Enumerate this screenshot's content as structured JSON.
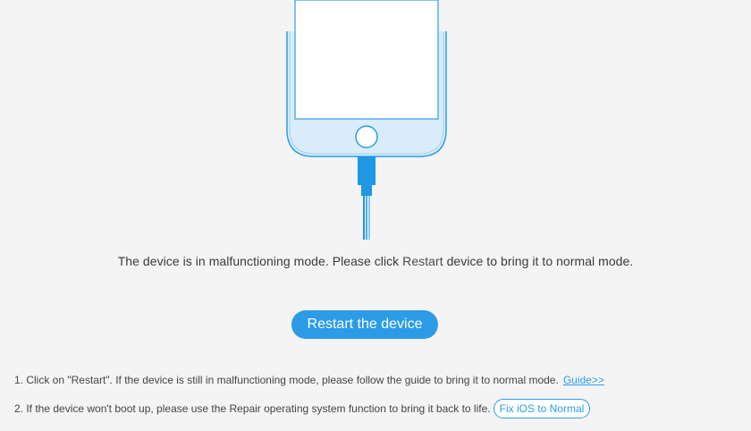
{
  "illustration": {
    "phone_outline_color": "#2c9ce6",
    "phone_fill_color": "#d9ecf9",
    "screen_color": "#ffffff",
    "cable_color": "#1f97e3"
  },
  "message": {
    "before": "The device is in malfunctioning mode. Please click ",
    "highlight": "Restart",
    "after": " device to bring it to normal mode."
  },
  "restart_button": {
    "label": "Restart the device",
    "color": "#2c9ce6"
  },
  "tips": {
    "tip1_text": "1. Click on \"Restart\". If the device is still in malfunctioning mode, please follow the guide to bring it to normal mode.",
    "guide_link": "Guide>>",
    "tip2_text": "2. If the device won't boot up, please use the Repair operating system function to bring it back to life.",
    "fix_button": "Fix iOS to Normal"
  }
}
